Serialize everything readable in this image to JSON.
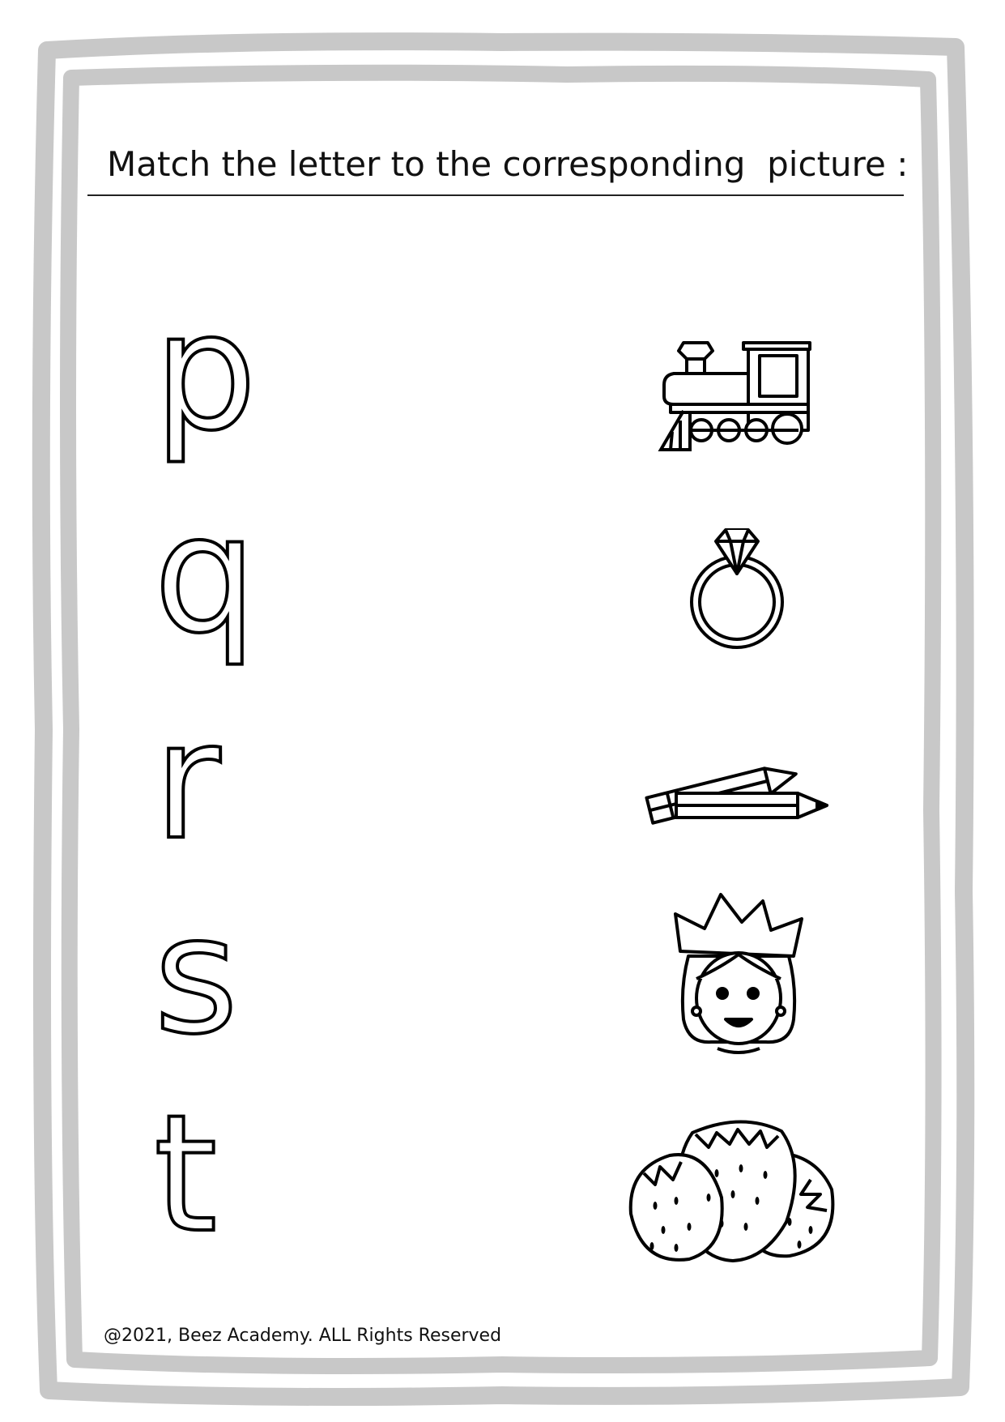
{
  "title": "Match the letter to the corresponding  picture :",
  "letters": [
    "p",
    "q",
    "r",
    "s",
    "t"
  ],
  "pictures": [
    "train-icon",
    "ring-icon",
    "pencils-icon",
    "queen-icon",
    "strawberries-icon"
  ],
  "footer": "@2021, Beez Academy. ALL Rights Reserved",
  "colors": {
    "frame": "#c8c8c8",
    "ink": "#000000",
    "paper": "#ffffff"
  }
}
